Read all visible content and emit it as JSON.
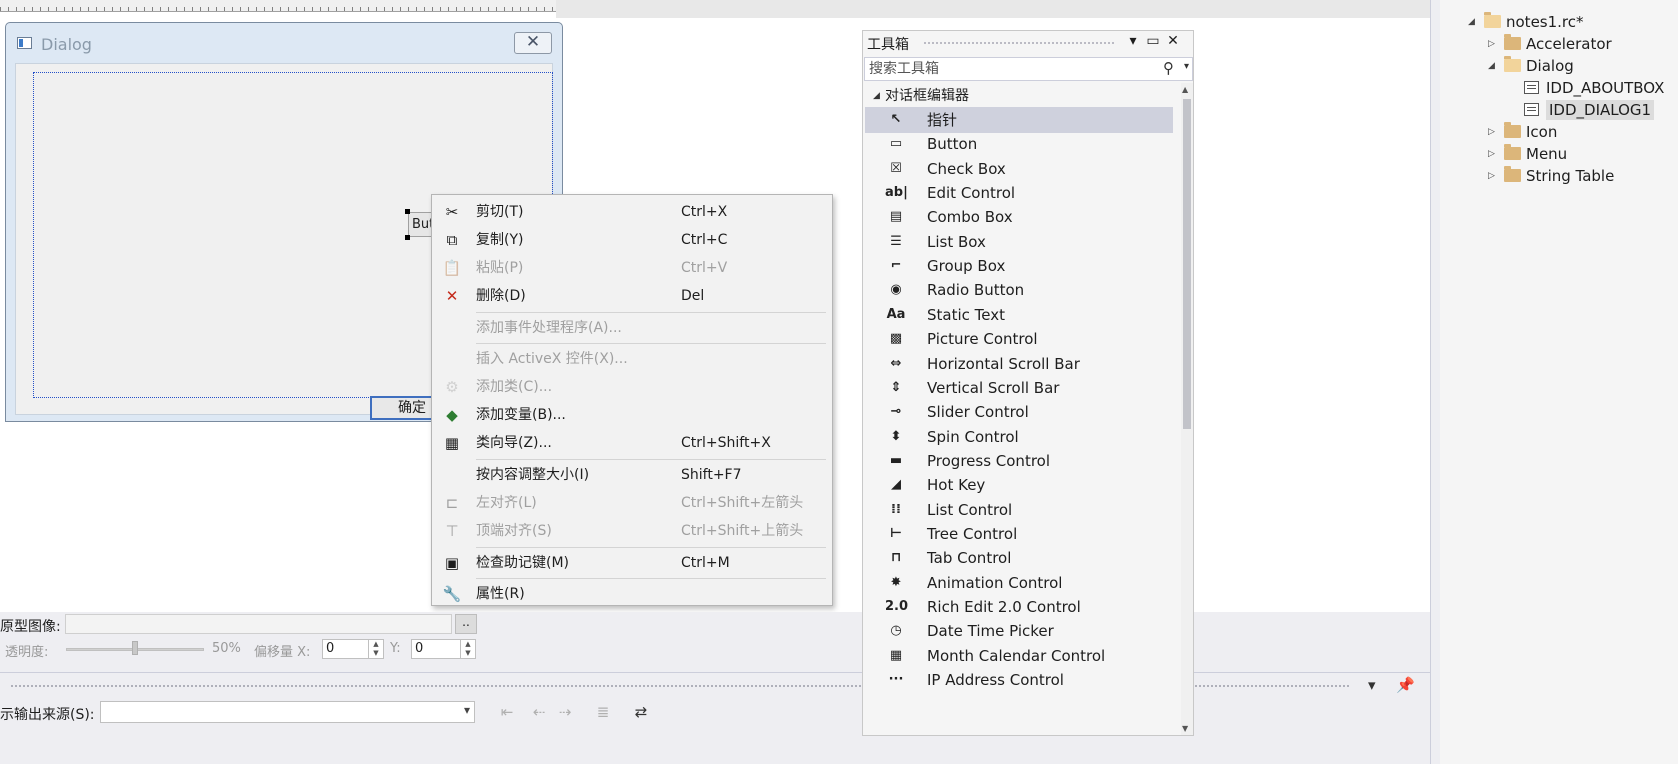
{
  "dialog": {
    "title": "Dialog",
    "close_glyph": "✕",
    "button_control_text": "Button1",
    "ok_button": "确定"
  },
  "context_menu": {
    "items": [
      {
        "icon": "✂",
        "label": "剪切(T)",
        "shortcut": "Ctrl+X",
        "enabled": true
      },
      {
        "icon": "⧉",
        "label": "复制(Y)",
        "shortcut": "Ctrl+C",
        "enabled": true
      },
      {
        "icon": "📋",
        "label": "粘贴(P)",
        "shortcut": "Ctrl+V",
        "enabled": false
      },
      {
        "icon": "✕",
        "label": "删除(D)",
        "shortcut": "Del",
        "enabled": true
      },
      {
        "icon": "",
        "label": "添加事件处理程序(A)...",
        "shortcut": "",
        "enabled": false
      },
      {
        "icon": "",
        "label": "插入 ActiveX 控件(X)...",
        "shortcut": "",
        "enabled": false
      },
      {
        "icon": "⚙",
        "label": "添加类(C)...",
        "shortcut": "",
        "enabled": false
      },
      {
        "icon": "◆",
        "label": "添加变量(B)...",
        "shortcut": "",
        "enabled": true
      },
      {
        "icon": "▦",
        "label": "类向导(Z)...",
        "shortcut": "Ctrl+Shift+X",
        "enabled": true
      },
      {
        "icon": "",
        "label": "按内容调整大小(I)",
        "shortcut": "Shift+F7",
        "enabled": true
      },
      {
        "icon": "⊏",
        "label": "左对齐(L)",
        "shortcut": "Ctrl+Shift+左箭头",
        "enabled": false
      },
      {
        "icon": "⊤",
        "label": "顶端对齐(S)",
        "shortcut": "Ctrl+Shift+上箭头",
        "enabled": false
      },
      {
        "icon": "▣",
        "label": "检查助记键(M)",
        "shortcut": "Ctrl+M",
        "enabled": true
      },
      {
        "icon": "🔧",
        "label": "属性(R)",
        "shortcut": "",
        "enabled": true
      }
    ]
  },
  "toolbox": {
    "title": "工具箱",
    "header_buttons": [
      "▾",
      "▭",
      "✕"
    ],
    "search_placeholder": "搜索工具箱",
    "group_label": "对话框编辑器",
    "items": [
      {
        "icon": "↖",
        "label": "指针",
        "selected": true
      },
      {
        "icon": "▭",
        "label": "Button"
      },
      {
        "icon": "☒",
        "label": "Check Box"
      },
      {
        "icon": "ab|",
        "label": "Edit Control"
      },
      {
        "icon": "▤",
        "label": "Combo Box"
      },
      {
        "icon": "☰",
        "label": "List Box"
      },
      {
        "icon": "⌐",
        "label": "Group Box"
      },
      {
        "icon": "◉",
        "label": "Radio Button"
      },
      {
        "icon": "Aa",
        "label": "Static Text"
      },
      {
        "icon": "▩",
        "label": "Picture Control"
      },
      {
        "icon": "⇔",
        "label": "Horizontal Scroll Bar"
      },
      {
        "icon": "⇕",
        "label": "Vertical Scroll Bar"
      },
      {
        "icon": "⊸",
        "label": "Slider Control"
      },
      {
        "icon": "⬍",
        "label": "Spin Control"
      },
      {
        "icon": "▬",
        "label": "Progress Control"
      },
      {
        "icon": "◢",
        "label": "Hot Key"
      },
      {
        "icon": "⁞⁞",
        "label": "List Control"
      },
      {
        "icon": "⊢",
        "label": "Tree Control"
      },
      {
        "icon": "⊓",
        "label": "Tab Control"
      },
      {
        "icon": "✸",
        "label": "Animation Control"
      },
      {
        "icon": "2.0",
        "label": "Rich Edit 2.0 Control"
      },
      {
        "icon": "◷",
        "label": "Date Time Picker"
      },
      {
        "icon": "▦",
        "label": "Month Calendar Control"
      },
      {
        "icon": "···",
        "label": "IP Address Control"
      }
    ]
  },
  "lower_panel": {
    "proto_label": "原型图像:",
    "browse_label": "..",
    "opacity_label": "透明度:",
    "opacity_value": "50%",
    "opacity_fraction": 0.5,
    "offset_label": "偏移量 X:",
    "offset_x": "0",
    "y_label": "Y:",
    "offset_y": "0",
    "output_header_buttons": "▾ 📌 ✕",
    "output_source_label": "示输出来源(S):",
    "output_source_value": ""
  },
  "solution_explorer": {
    "nodes": [
      {
        "label": "notes1.rc*",
        "type": "folder-open",
        "level": 1,
        "arrow": "◢"
      },
      {
        "label": "Accelerator",
        "type": "folder",
        "level": 2,
        "arrow": "▷"
      },
      {
        "label": "Dialog",
        "type": "folder-open",
        "level": 2,
        "arrow": "◢"
      },
      {
        "label": "IDD_ABOUTBOX",
        "type": "resource",
        "level": 3,
        "arrow": ""
      },
      {
        "label": "IDD_DIALOG1",
        "type": "resource",
        "level": 3,
        "arrow": "",
        "selected": true
      },
      {
        "label": "Icon",
        "type": "folder",
        "level": 2,
        "arrow": "▷"
      },
      {
        "label": "Menu",
        "type": "folder",
        "level": 2,
        "arrow": "▷"
      },
      {
        "label": "String Table",
        "type": "folder",
        "level": 2,
        "arrow": "▷"
      }
    ]
  }
}
